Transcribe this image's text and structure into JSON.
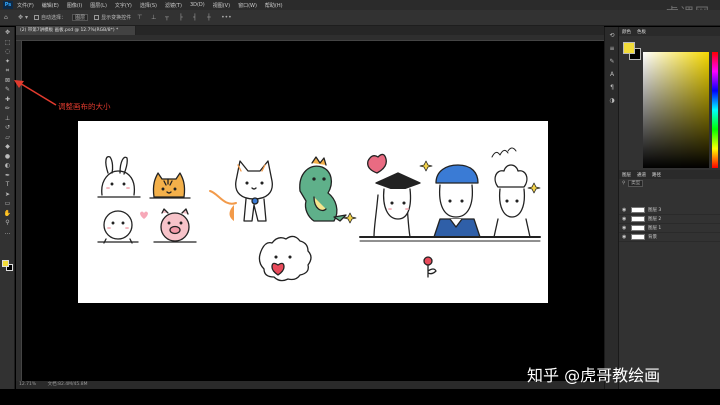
{
  "app": {
    "logo": "Ps"
  },
  "menubar": {
    "items": [
      "文件(F)",
      "编辑(E)",
      "图像(I)",
      "图层(L)",
      "文字(Y)",
      "选择(S)",
      "滤镜(T)",
      "3D(D)",
      "视图(V)",
      "窗口(W)",
      "帮助(H)"
    ]
  },
  "watermark_top": "虎课网",
  "optbar": {
    "auto_select_label": "自动选择：",
    "auto_select_value": "图层",
    "show_transform_label": "显示变换控件",
    "align_glyphs": [
      "⊤",
      "⊥",
      "┬",
      "├",
      "┤",
      "┼"
    ]
  },
  "document": {
    "tab_title": "(2) 带第7讲模板 画板.psd @ 12.7%(RGB/8*) *",
    "status_zoom": "12.71%",
    "status_doc": "文档:82.4M/45.8M"
  },
  "annotation": {
    "label": "调整画布的大小"
  },
  "watermark_bottom": "知乎 @虎哥教绘画",
  "colors": {
    "foreground": "#f2dc3a",
    "background": "#000000",
    "annotation": "#e23b2e"
  },
  "panels": {
    "color_tabs": [
      "颜色",
      "色板"
    ],
    "layers_tabs": [
      "图层",
      "通道",
      "路径"
    ],
    "layer_kind": "类型",
    "layers": [
      "图层 3",
      "图层 2",
      "图层 1",
      "背景"
    ]
  }
}
